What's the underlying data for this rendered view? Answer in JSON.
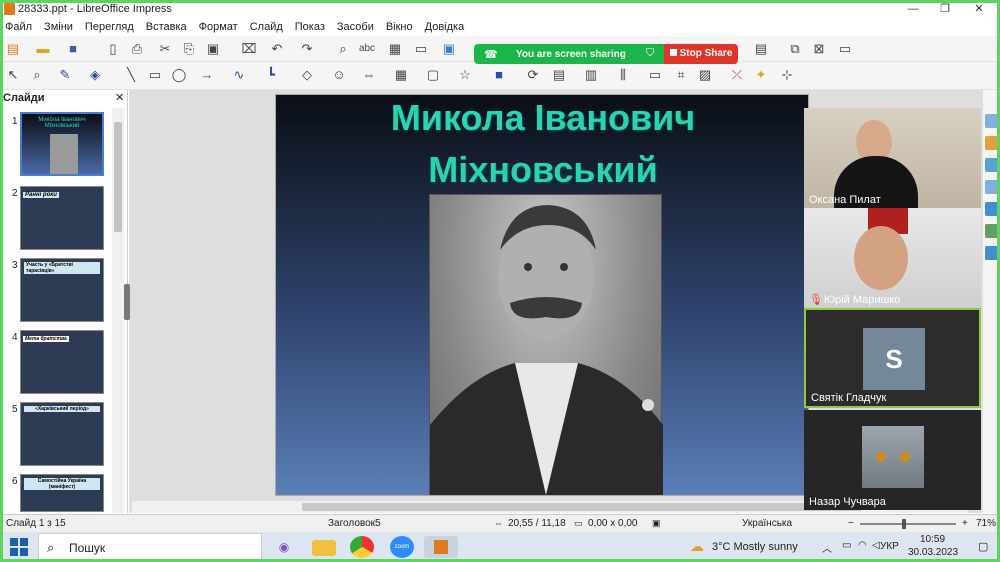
{
  "window": {
    "title": "28333.ppt - LibreOffice Impress"
  },
  "menu": [
    "Файл",
    "Зміни",
    "Перегляд",
    "Вставка",
    "Формат",
    "Слайд",
    "Показ",
    "Засоби",
    "Вікно",
    "Довідка"
  ],
  "share_banner": {
    "message": "You are screen sharing",
    "stop_label": "Stop Share"
  },
  "slide_panel": {
    "header": "Слайди",
    "thumbs": [
      {
        "num": "1",
        "title": "Микола Іванович Міхновський"
      },
      {
        "num": "2",
        "title": "Ранні роки"
      },
      {
        "num": "3",
        "title": "Участь у «Братстві тарасівців»"
      },
      {
        "num": "4",
        "title": "Мета братства"
      },
      {
        "num": "5",
        "title": "«Харківський період»"
      },
      {
        "num": "6",
        "title": "Самостійна Україна (маніфест)"
      }
    ]
  },
  "slide": {
    "title_line1": "Микола Іванович",
    "title_line2": "Міхновський"
  },
  "participants": [
    {
      "name": "Оксана Пилат"
    },
    {
      "name": "Юрій Маришко"
    },
    {
      "name": "Святік Гладчук",
      "initial": "S"
    },
    {
      "name": "Назар Чучвара"
    }
  ],
  "status": {
    "slide_info": "Слайд 1 з 15",
    "layout": "Заголовок5",
    "position": "20,55 / 11,18",
    "size": "0,00 x 0,00",
    "language": "Українська",
    "zoom": "71%"
  },
  "taskbar": {
    "search_placeholder": "Пошук",
    "weather": "3°C  Mostly sunny",
    "lang": "УКР",
    "time": "10:59",
    "date": "30.03.2023"
  },
  "colors": {
    "share_green": "#1bb54a",
    "stop_red": "#e0352b",
    "slide_title": "#2bd4b0",
    "frame": "#5fd35f"
  }
}
